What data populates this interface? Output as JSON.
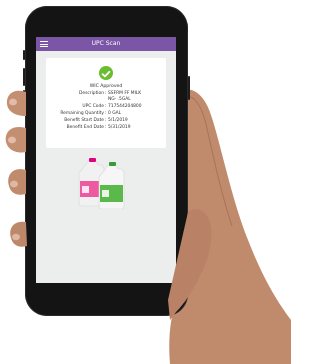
{
  "header": {
    "title": "UPC Scan",
    "menu_icon": "hamburger-menu-icon"
  },
  "result": {
    "status_icon": "check-circle-icon",
    "status": "WIC Approved",
    "fields": [
      {
        "label": "Description",
        "value": "SSFRM FF MILK"
      },
      {
        "label": "",
        "value": "NG- .5GAL"
      },
      {
        "label": "UPC Code",
        "value": "717544204800"
      },
      {
        "label": "Remaining Quantity",
        "value": "0 GAL"
      },
      {
        "label": "Benefit Start Date",
        "value": "5/1/2019"
      },
      {
        "label": "Benefit End Date",
        "value": "5/31/2019"
      }
    ]
  },
  "product_image": "milk-jugs-image",
  "colors": {
    "header": "#7b56a6",
    "check": "#6bbd2f",
    "screen_bg": "#eceeed"
  }
}
